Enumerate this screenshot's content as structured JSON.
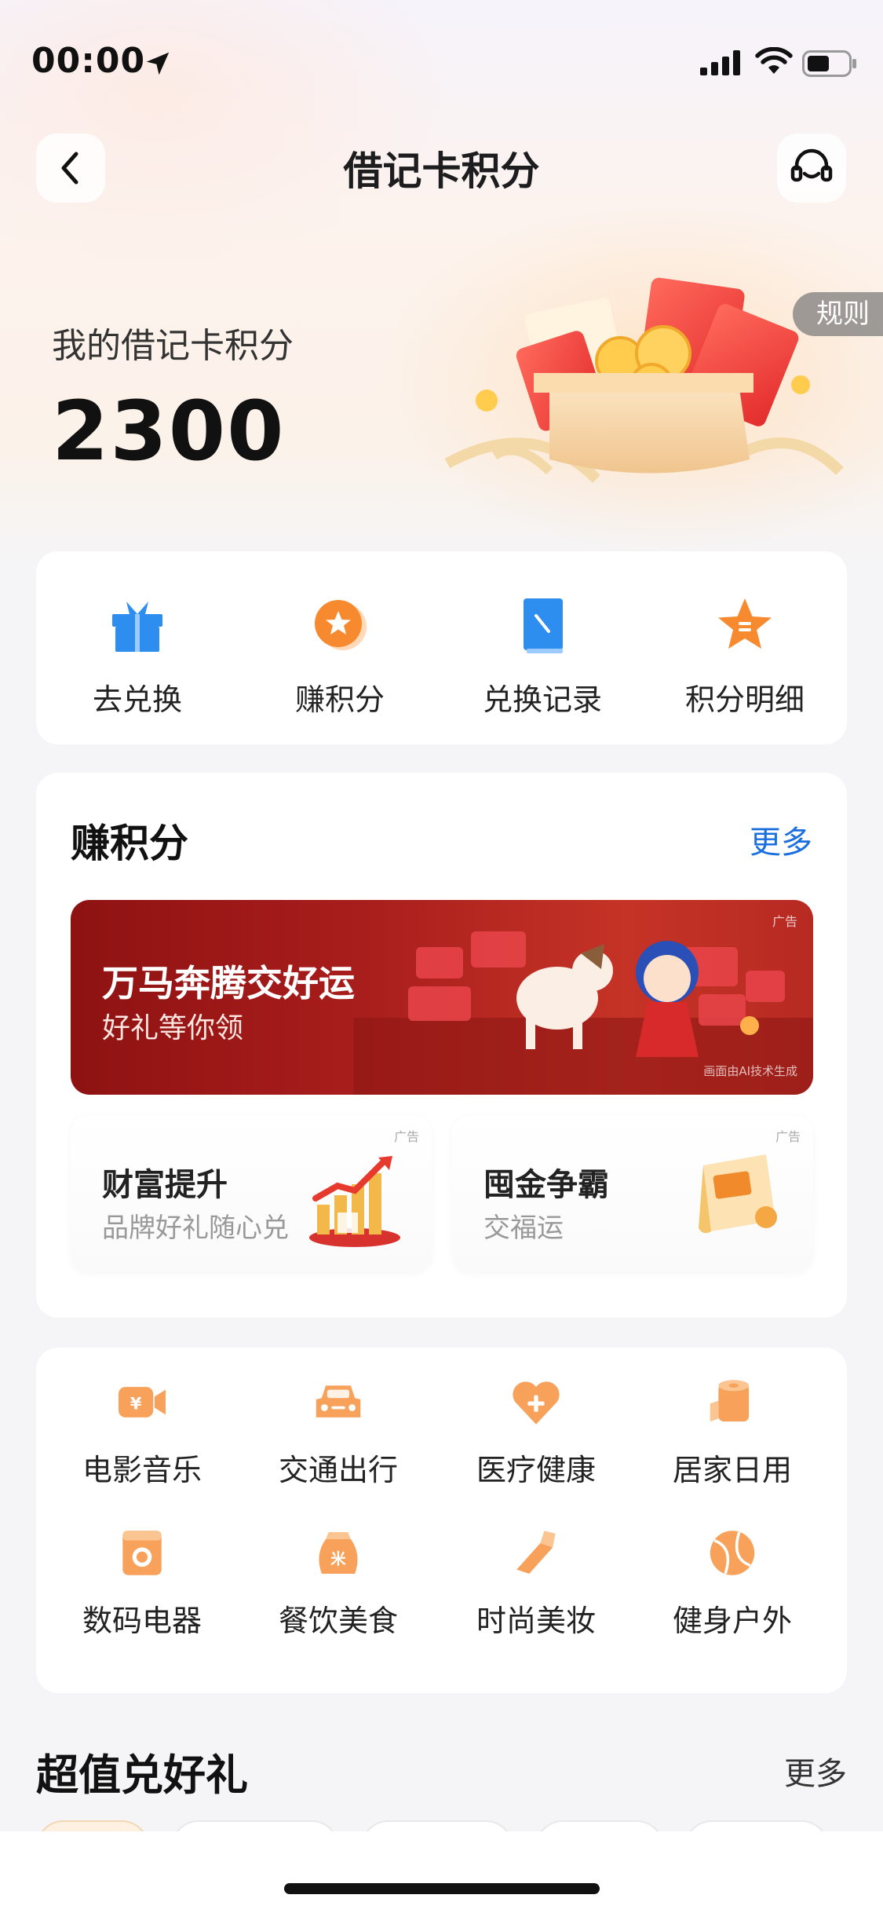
{
  "status_bar": {
    "time": "00:00"
  },
  "header": {
    "title": "借记卡积分"
  },
  "hero": {
    "rules_label": "规则",
    "points_label": "我的借记卡积分",
    "points_value": "2300"
  },
  "quick_actions": [
    {
      "label": "去兑换",
      "icon": "gift-icon"
    },
    {
      "label": "赚积分",
      "icon": "star-coin-icon"
    },
    {
      "label": "兑换记录",
      "icon": "record-icon"
    },
    {
      "label": "积分明细",
      "icon": "star-detail-icon"
    }
  ],
  "earn": {
    "title": "赚积分",
    "more_label": "更多",
    "banner": {
      "ad_label": "广告",
      "title": "万马奔腾交好运",
      "subtitle": "好礼等你领",
      "note": "画面由AI技术生成"
    },
    "promos": [
      {
        "ad_label": "广告",
        "title": "财富提升",
        "subtitle": "品牌好礼随心兑"
      },
      {
        "ad_label": "广告",
        "title": "囤金争霸",
        "subtitle": "交福运"
      }
    ]
  },
  "categories": [
    {
      "label": "电影音乐",
      "icon": "camera-yuan-icon"
    },
    {
      "label": "交通出行",
      "icon": "car-icon"
    },
    {
      "label": "医疗健康",
      "icon": "heart-plus-icon"
    },
    {
      "label": "居家日用",
      "icon": "tissue-roll-icon"
    },
    {
      "label": "数码电器",
      "icon": "washing-machine-icon"
    },
    {
      "label": "餐饮美食",
      "icon": "rice-bag-icon"
    },
    {
      "label": "时尚美妆",
      "icon": "lipstick-icon"
    },
    {
      "label": "健身户外",
      "icon": "ball-icon"
    }
  ],
  "gifts": {
    "title": "超值兑好礼",
    "more_label": "更多"
  },
  "colors": {
    "accent_orange": "#f7a15a",
    "link_blue": "#1a6fe0",
    "banner_red": "#a91e1c"
  }
}
